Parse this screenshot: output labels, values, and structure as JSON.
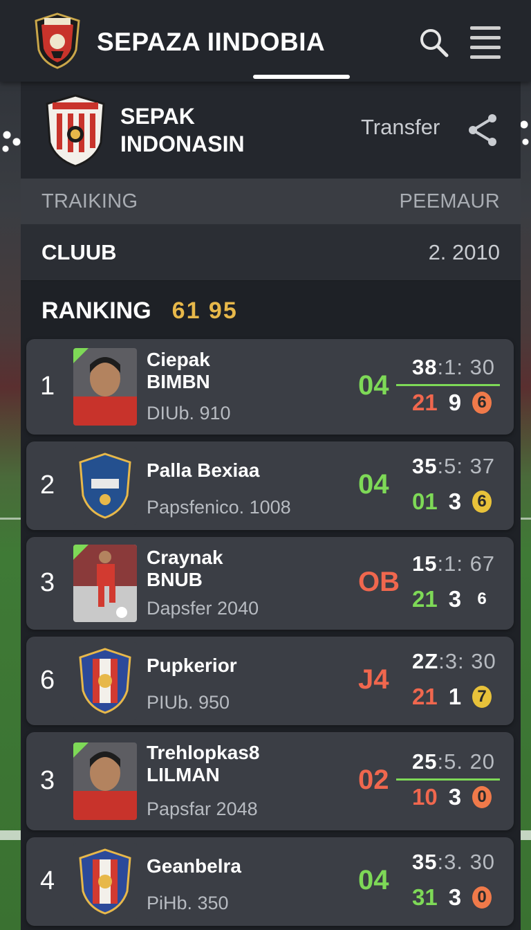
{
  "appbar": {
    "title": "SEPAZA IINDOBIA",
    "logo_icon": "club-crest-icon",
    "search_icon": "search-icon",
    "menu_icon": "hamburger-menu-icon"
  },
  "club": {
    "name": "SEPAK\nINDONASIN",
    "transfer_label": "Transfer",
    "share_icon": "share-icon"
  },
  "tabs": {
    "left": "TRAIKING",
    "right": "PEEMAUR"
  },
  "club_row": {
    "label": "CLUUB",
    "value": "2. 2010"
  },
  "ranking": {
    "label": "RANKING",
    "value": "61 95"
  },
  "colors": {
    "green": "#7ed957",
    "red": "#f0674e",
    "orange": "#f07a4a",
    "yellow": "#e8c23a",
    "gold": "#e7b84a"
  },
  "rows": [
    {
      "rank": "1",
      "name": "Ciepak\nBIMBN",
      "sub": "DIUb. 910",
      "score": "04",
      "score_color": "green",
      "time_a": "38",
      "time_b": ":1: 30",
      "stat1": "21",
      "stat1_color": "red",
      "stat2": "9",
      "stat3": "6",
      "badge": "orange",
      "thumb": "player"
    },
    {
      "rank": "2",
      "name": "Palla Bexiaa",
      "sub": "Papsfenico. 1008",
      "score": "04",
      "score_color": "green",
      "time_a": "35",
      "time_b": ":5: 37",
      "stat1": "01",
      "stat1_color": "green",
      "stat2": "3",
      "stat3": "6",
      "badge": "yellow",
      "thumb": "crest-blue"
    },
    {
      "rank": "3",
      "name": "Craynak\nBNUB",
      "sub": "Dapsfer 2040",
      "score": "OB",
      "score_color": "red",
      "time_a": "15",
      "time_b": ":1: 67",
      "stat1": "21",
      "stat1_color": "green",
      "stat2": "3",
      "stat3": "6",
      "badge": "none",
      "thumb": "player-kick"
    },
    {
      "rank": "6",
      "name": "Pupkerior",
      "sub": "PIUb. 950",
      "score": "J4",
      "score_color": "red",
      "time_a": "2Z",
      "time_b": ":3: 30",
      "stat1": "21",
      "stat1_color": "red",
      "stat2": "1",
      "stat3": "7",
      "badge": "yellow",
      "thumb": "crest-red"
    },
    {
      "rank": "3",
      "name": "Trehlopkas8\nLILMAN",
      "sub": "Papsfar 2048",
      "score": "02",
      "score_color": "red",
      "time_a": "25",
      "time_b": ":5. 20",
      "stat1": "10",
      "stat1_color": "red",
      "stat2": "3",
      "stat3": "0",
      "badge": "orange",
      "thumb": "player"
    },
    {
      "rank": "4",
      "name": "Geanbelra",
      "sub": "PiHb. 350",
      "score": "04",
      "score_color": "green",
      "time_a": "35",
      "time_b": ":3. 30",
      "stat1": "31",
      "stat1_color": "green",
      "stat2": "3",
      "stat3": "0",
      "badge": "orange",
      "thumb": "crest-red"
    }
  ]
}
